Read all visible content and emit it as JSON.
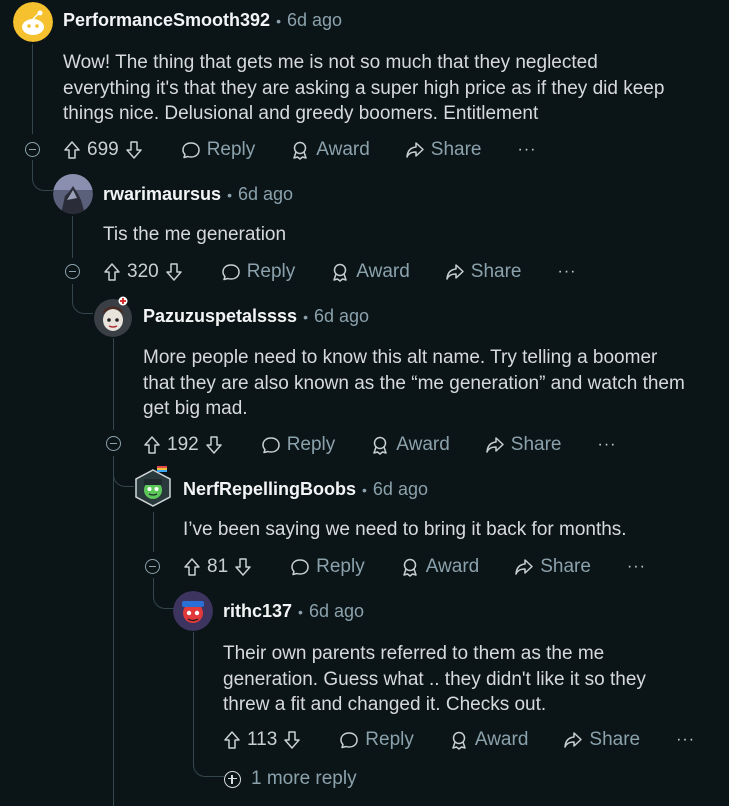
{
  "comments": [
    {
      "username": "PerformanceSmooth392",
      "time": "6d ago",
      "body": [
        "Wow! The thing that gets me is not so much that they neglected",
        "everything it's that they are asking a super high price as if they did keep",
        "things nice. Delusional and greedy boomers. Entitlement"
      ],
      "votes": "699"
    },
    {
      "username": "rwarimaursus",
      "time": "6d ago",
      "body": [
        "Tis the me generation"
      ],
      "votes": "320"
    },
    {
      "username": "Pazuzuspetalssss",
      "time": "6d ago",
      "body": [
        "More people need to know this alt name. Try telling a boomer",
        "that they are also known as the “me generation” and watch them",
        "get big mad."
      ],
      "votes": "192"
    },
    {
      "username": "NerfRepellingBoobs",
      "time": "6d ago",
      "body": [
        "I’ve been saying we need to bring it back for months."
      ],
      "votes": "81"
    },
    {
      "username": "rithc137",
      "time": "6d ago",
      "body": [
        "Their own parents referred to them as the me",
        "generation. Guess what .. they didn't like it so they",
        "threw a fit and changed it. Checks out."
      ],
      "votes": "113"
    }
  ],
  "actions": {
    "reply": "Reply",
    "award": "Award",
    "share": "Share",
    "more": "···",
    "separator": "•"
  },
  "more_replies": "1 more reply",
  "colors": {
    "background": "#0b1416",
    "text": "#d7dadc",
    "muted": "#8ba2ad",
    "thread_line": "#33464c"
  },
  "icons": [
    "upvote-icon",
    "downvote-icon",
    "comment-bubble-icon",
    "award-icon",
    "share-icon",
    "collapse-icon",
    "expand-plus-icon"
  ]
}
